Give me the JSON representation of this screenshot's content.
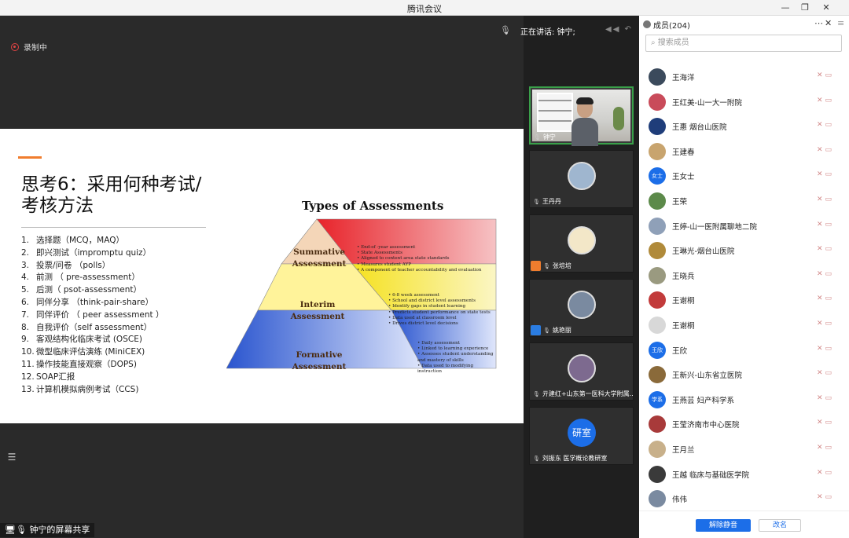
{
  "window": {
    "title": "腾讯会议"
  },
  "stage": {
    "recording_label": "录制中",
    "share_label": "钟宁的屏幕共享"
  },
  "slide": {
    "heading": "思考6：采用何种考试/考核方法",
    "items": [
      {
        "num": "1.",
        "text": "选择题（MCQ，MAQ）"
      },
      {
        "num": "2.",
        "text": "即兴测试（impromptu quiz）"
      },
      {
        "num": "3.",
        "text": "投票/问卷 （polls）"
      },
      {
        "num": "4.",
        "text": "前测 （ pre-assessment）"
      },
      {
        "num": "5.",
        "text": "后测（ psot-assessment）"
      },
      {
        "num": "6.",
        "text": "同伴分享 （think-pair-share）"
      },
      {
        "num": "7.",
        "text": "同伴评价 （ peer assessment ）"
      },
      {
        "num": "8.",
        "text": "自我评价（self assessment）"
      },
      {
        "num": "9.",
        "text": "客观结构化临床考试 (OSCE)"
      },
      {
        "num": "10.",
        "text": "微型临床评估演练 (MiniCEX)"
      },
      {
        "num": "11.",
        "text": "操作技能直接观察（DOPS)"
      },
      {
        "num": "12.",
        "text": "SOAP汇报"
      },
      {
        "num": "13.",
        "text": "计算机模拟病例考试（CCS)"
      }
    ],
    "pyramid_title": "Types of Assessments",
    "levels": [
      {
        "label": "Summative Assessment",
        "bullets": [
          "End-of -year assessment",
          "State Assessments",
          "Aligned to content area state standards",
          "Measures student AYP",
          "A component of teacher accountability and evaluation"
        ]
      },
      {
        "label": "Interim Assessment",
        "bullets": [
          "6-8 week assessment",
          "School and district level assessments",
          "Identify gaps in student learning",
          "Predicts student performance on state tests",
          "Data used at classroom level",
          "Drives district level decisions"
        ]
      },
      {
        "label": "Formative Assessment",
        "bullets": [
          "Daily assessment",
          "Linked to learning experience",
          "Assesses student understanding and mastery of skills",
          "Data used to modifying instruction"
        ]
      }
    ]
  },
  "video_strip": {
    "speaking_label": "正在讲话: 钟宁;",
    "tiles": [
      {
        "name": "钟宁",
        "kind": "camera"
      },
      {
        "name": "王丹丹",
        "kind": "avatar",
        "color": "#9fb6cf"
      },
      {
        "name": "张培培",
        "kind": "avatar",
        "color": "#f3e7c8"
      },
      {
        "name": "姚艳丽",
        "kind": "avatar",
        "color": "#7a8aa0"
      },
      {
        "name": "亓建红+山东第一医科大学附属...",
        "kind": "avatar",
        "color": "#7d6a8f"
      },
      {
        "name": "刘振东 医学概论教研室",
        "kind": "text-avatar",
        "avatar_text": "研室",
        "color": "#1c6ee8"
      }
    ]
  },
  "members_panel": {
    "title": "成员(204)",
    "search_placeholder": "搜索成员",
    "members": [
      {
        "name": "王海洋",
        "color": "#3b4a5c"
      },
      {
        "name": "王红美-山一大一附院",
        "color": "#c94b5a"
      },
      {
        "name": "王惠 烟台山医院",
        "color": "#1f3d7a"
      },
      {
        "name": "王建春",
        "color": "#c8a46e"
      },
      {
        "name": "王女士",
        "color": "#1c6ee8",
        "text": "女士"
      },
      {
        "name": "王荣",
        "color": "#5c8a4a"
      },
      {
        "name": "王婷-山一医附属聊地二院",
        "color": "#8fa0b8"
      },
      {
        "name": "王琳光-烟台山医院",
        "color": "#b08a3a"
      },
      {
        "name": "王晓兵",
        "color": "#9a9a80"
      },
      {
        "name": "王谢桐",
        "color": "#c23b3b"
      },
      {
        "name": "王谢桐",
        "color": "#d8d8d8"
      },
      {
        "name": "王欣",
        "color": "#1c6ee8",
        "text": "王欣"
      },
      {
        "name": "王新兴-山东省立医院",
        "color": "#8a6a3a"
      },
      {
        "name": "王燕芸 妇产科学系",
        "color": "#1c6ee8",
        "text": "学系"
      },
      {
        "name": "王莹济南市中心医院",
        "color": "#a83a3a"
      },
      {
        "name": "王月兰",
        "color": "#c8b08a"
      },
      {
        "name": "王越 临床与基础医学院",
        "color": "#3a3a3a"
      },
      {
        "name": "伟伟",
        "color": "#7a8aa0"
      }
    ],
    "unmute_all": "解除静音",
    "rename": "改名"
  }
}
